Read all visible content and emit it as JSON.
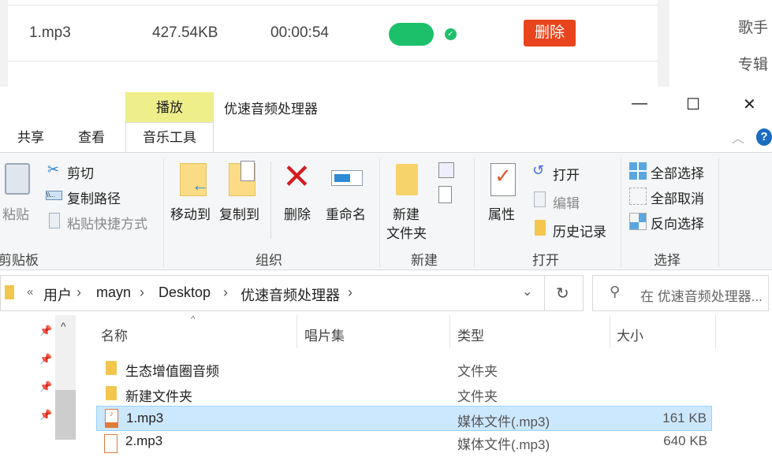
{
  "web": {
    "file_name": "1.mp3",
    "file_size": "427.54KB",
    "duration": "00:00:54",
    "delete_label": "删除",
    "side_labels": [
      "歌手",
      "专辑"
    ]
  },
  "window": {
    "context_tab": "播放",
    "title": "优速音频处理器",
    "controls": {
      "minimize": "—",
      "maximize": "☐",
      "close": "✕"
    }
  },
  "tabs": [
    "共享",
    "查看",
    "音乐工具"
  ],
  "ribbon": {
    "clipboard": {
      "paste": "粘贴",
      "cut": "剪切",
      "copy_path": "复制路径",
      "paste_shortcut": "粘贴快捷方式",
      "label": "剪贴板"
    },
    "organize": {
      "move_to": "移动到",
      "copy_to": "复制到",
      "delete": "删除",
      "rename": "重命名",
      "label": "组织"
    },
    "new": {
      "new_folder_line1": "新建",
      "new_folder_line2": "文件夹",
      "label": "新建"
    },
    "open": {
      "properties": "属性",
      "open": "打开",
      "edit": "编辑",
      "history": "历史记录",
      "label": "打开"
    },
    "select": {
      "select_all": "全部选择",
      "select_none": "全部取消",
      "invert": "反向选择",
      "label": "选择"
    }
  },
  "address": {
    "crumbs": [
      "用户",
      "mayn",
      "Desktop",
      "优速音频处理器"
    ],
    "search_placeholder": "在 优速音频处理器..."
  },
  "columns": [
    "名称",
    "唱片集",
    "类型",
    "大小"
  ],
  "files": [
    {
      "name": "生态增值圈音频",
      "type": "文件夹",
      "size": "",
      "kind": "folder"
    },
    {
      "name": "新建文件夹",
      "type": "文件夹",
      "size": "",
      "kind": "folder"
    },
    {
      "name": "1.mp3",
      "type": "媒体文件(.mp3)",
      "size": "161 KB",
      "kind": "mp3",
      "selected": true
    },
    {
      "name": "2.mp3",
      "type": "媒体文件(.mp3)",
      "size": "640 KB",
      "kind": "mp3"
    }
  ],
  "colors": {
    "accent_green": "#1dc06a",
    "delete_red": "#e8441d",
    "context_tab": "#eeef8a",
    "selection": "#cce8ff"
  }
}
